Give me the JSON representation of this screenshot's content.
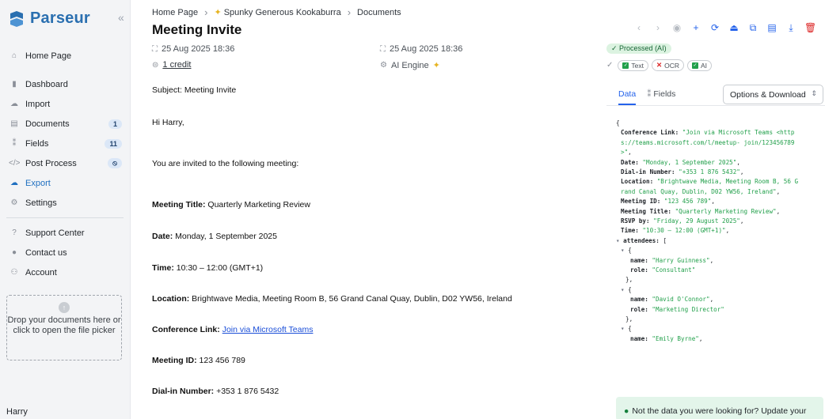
{
  "brand": {
    "name": "Parseur",
    "collapse_icon": "chevrons-left-icon"
  },
  "sidebar": {
    "items": [
      {
        "label": "Home Page",
        "icon": "house-icon",
        "badge": ""
      },
      {
        "label": "Dashboard",
        "icon": "bar-chart-icon",
        "badge": ""
      },
      {
        "label": "Import",
        "icon": "cloud-icon",
        "badge": ""
      },
      {
        "label": "Documents",
        "icon": "document-icon",
        "badge": "1"
      },
      {
        "label": "Fields",
        "icon": "fields-icon",
        "badge": "11"
      },
      {
        "label": "Post Process",
        "icon": "code-icon",
        "badge": "⦸"
      },
      {
        "label": "Export",
        "icon": "export-cloud-icon",
        "badge": ""
      },
      {
        "label": "Settings",
        "icon": "gear-icon",
        "badge": ""
      },
      {
        "label": "Support Center",
        "icon": "question-icon",
        "badge": ""
      },
      {
        "label": "Contact us",
        "icon": "chat-icon",
        "badge": ""
      },
      {
        "label": "Account",
        "icon": "users-icon",
        "badge": ""
      }
    ],
    "dropzone": "Drop your documents here or click to open the file picker",
    "user": "Harry"
  },
  "breadcrumb": {
    "home": "Home Page",
    "mailbox": "Spunky Generous Kookaburra",
    "section": "Documents"
  },
  "document": {
    "title": "Meeting Invite",
    "received": "25 Aug 2025 18:36",
    "processed": "25 Aug 2025 18:36",
    "credits": "1 credit",
    "engine": "AI Engine"
  },
  "email": {
    "subject": "Subject: Meeting Invite",
    "greeting": "Hi Harry,",
    "intro": "You are invited to the following meeting:",
    "fields": [
      {
        "label": "Meeting Title:",
        "value": " Quarterly Marketing Review"
      },
      {
        "label": "Date:",
        "value": " Monday, 1 September 2025"
      },
      {
        "label": "Time:",
        "value": " 10:30 – 12:00 (GMT+1)"
      },
      {
        "label": "Location:",
        "value": " Brightwave Media, Meeting Room B, 56 Grand Canal Quay, Dublin, D02 YW56, Ireland"
      },
      {
        "label": "Conference Link:",
        "value": "Join via Microsoft Teams"
      },
      {
        "label": "Meeting ID:",
        "value": " 123 456 789"
      },
      {
        "label": "Dial-in Number:",
        "value": " +353 1 876 5432"
      }
    ]
  },
  "status": {
    "processed": "✓ Processed (AI)",
    "text": "Text",
    "ocr": "OCR",
    "ai": "AI"
  },
  "tabs": {
    "data": "Data",
    "fields": "Fields",
    "options": "Options & Download"
  },
  "json_rows": [
    {
      "t": "{"
    },
    {
      "i": 1,
      "k": "Conference Link:",
      "v": " \"Join via Microsoft Teams <http"
    },
    {
      "i": 1,
      "v": "s://teams.microsoft.com/l/meetup- join/123456789"
    },
    {
      "i": 1,
      "v": ">\"",
      "tail": ","
    },
    {
      "i": 1,
      "k": "Date:",
      "v": " \"Monday, 1 September 2025\"",
      "tail": ","
    },
    {
      "i": 1,
      "k": "Dial-in Number:",
      "v": " \"+353 1 876 5432\"",
      "tail": ","
    },
    {
      "i": 1,
      "k": "Location:",
      "v": " \"Brightwave Media, Meeting Room B, 56 G"
    },
    {
      "i": 1,
      "v": "rand Canal Quay, Dublin, D02 YW56, Ireland\"",
      "tail": ","
    },
    {
      "i": 1,
      "k": "Meeting ID:",
      "v": " \"123 456 789\"",
      "tail": ","
    },
    {
      "i": 1,
      "k": "Meeting Title:",
      "v": " \"Quarterly Marketing Review\"",
      "tail": ","
    },
    {
      "i": 1,
      "k": "RSVP by:",
      "v": " \"Friday, 29 August 2025\"",
      "tail": ","
    },
    {
      "i": 1,
      "k": "Time:",
      "v": " \"10:30 – 12:00 (GMT+1)\"",
      "tail": ","
    },
    {
      "i": 0,
      "tri": true,
      "k": "attendees:",
      "t": " ["
    },
    {
      "i": 1,
      "tri": true,
      "t": "{"
    },
    {
      "i": 3,
      "k": "name:",
      "v": " \"Harry Guinness\"",
      "tail": ","
    },
    {
      "i": 3,
      "k": "role:",
      "v": " \"Consultant\""
    },
    {
      "i": 2,
      "t": "},"
    },
    {
      "i": 1,
      "tri": true,
      "t": "{"
    },
    {
      "i": 3,
      "k": "name:",
      "v": " \"David O'Connor\"",
      "tail": ","
    },
    {
      "i": 3,
      "k": "role:",
      "v": " \"Marketing Director\""
    },
    {
      "i": 2,
      "t": "},"
    },
    {
      "i": 1,
      "tri": true,
      "t": "{"
    },
    {
      "i": 3,
      "k": "name:",
      "v": " \"Emily Byrne\"",
      "tail": ","
    }
  ],
  "notice": "Not the data you were looking for? Update your"
}
